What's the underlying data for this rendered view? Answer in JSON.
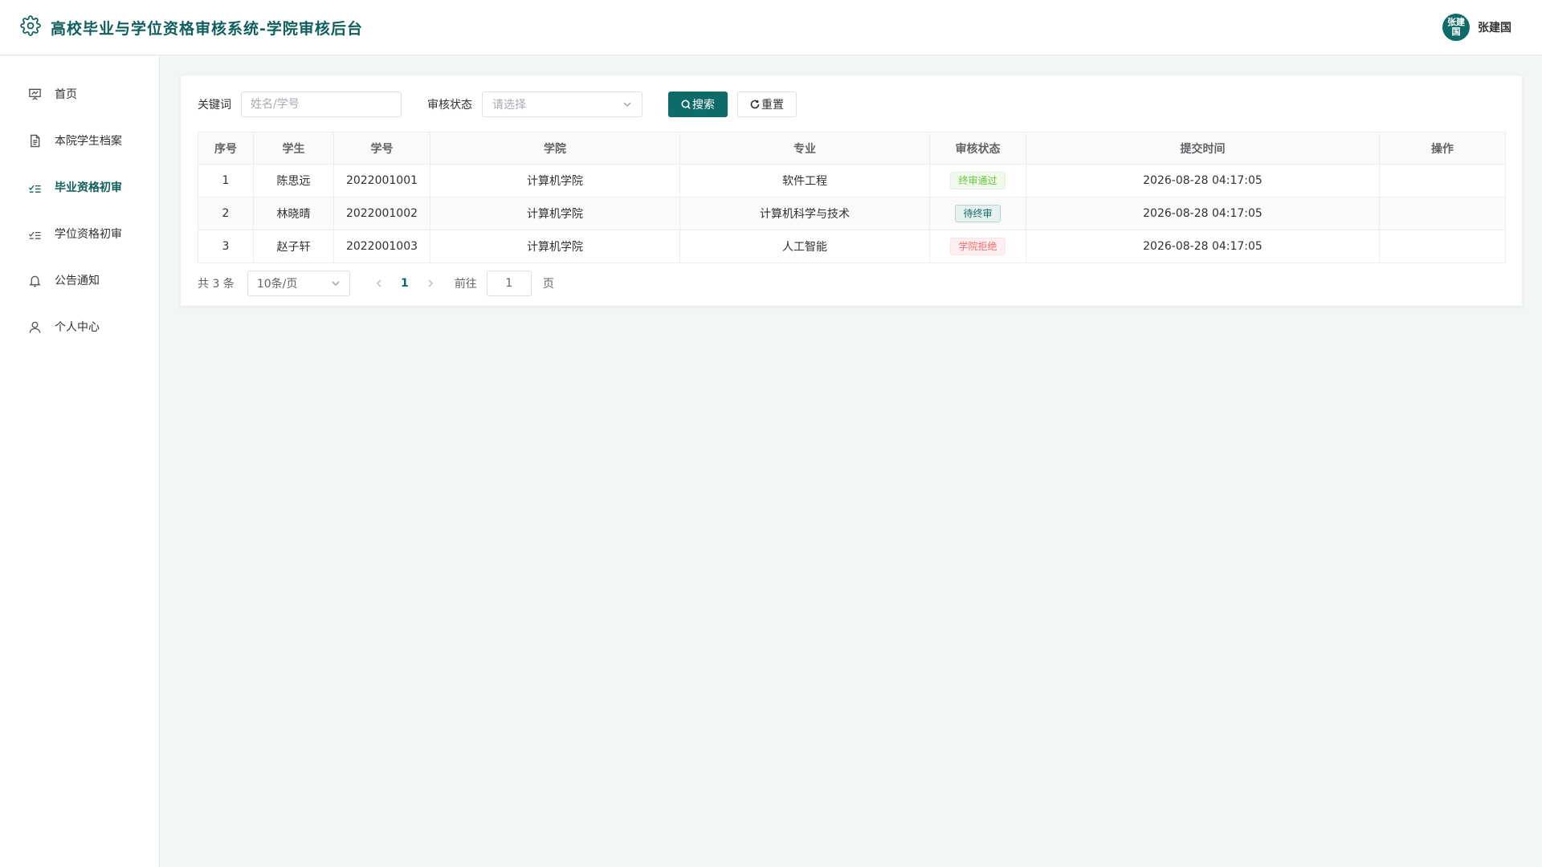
{
  "app": {
    "title": "高校毕业与学位资格审核系统-学院审核后台"
  },
  "user": {
    "name": "张建国",
    "avatar_text": "张建国"
  },
  "sidebar": {
    "items": [
      {
        "label": "首页",
        "icon": "presentation-icon"
      },
      {
        "label": "本院学生档案",
        "icon": "document-icon"
      },
      {
        "label": "毕业资格初审",
        "icon": "checklist-icon",
        "active": true
      },
      {
        "label": "学位资格初审",
        "icon": "checklist-icon"
      },
      {
        "label": "公告通知",
        "icon": "bell-icon"
      },
      {
        "label": "个人中心",
        "icon": "user-icon"
      }
    ]
  },
  "filters": {
    "keyword_label": "关键词",
    "keyword_placeholder": "姓名/学号",
    "keyword_value": "",
    "status_label": "审核状态",
    "status_placeholder": "请选择",
    "search_label": "搜索",
    "reset_label": "重置"
  },
  "table": {
    "headers": [
      "序号",
      "学生",
      "学号",
      "学院",
      "专业",
      "审核状态",
      "提交时间",
      "操作"
    ],
    "rows": [
      {
        "index": "1",
        "student": "陈思远",
        "id": "2022001001",
        "college": "计算机学院",
        "major": "软件工程",
        "status": "终审通过",
        "status_type": "success",
        "time": "2026-08-28 04:17:05",
        "action": ""
      },
      {
        "index": "2",
        "student": "林晓晴",
        "id": "2022001002",
        "college": "计算机学院",
        "major": "计算机科学与技术",
        "status": "待终审",
        "status_type": "info",
        "time": "2026-08-28 04:17:05",
        "action": ""
      },
      {
        "index": "3",
        "student": "赵子轩",
        "id": "2022001003",
        "college": "计算机学院",
        "major": "人工智能",
        "status": "学院拒绝",
        "status_type": "danger",
        "time": "2026-08-28 04:17:05",
        "action": ""
      }
    ]
  },
  "pagination": {
    "total_text": "共 3 条",
    "page_size": "10条/页",
    "current_page": "1",
    "goto_label": "前往",
    "goto_value": "1",
    "page_unit": "页"
  },
  "colors": {
    "primary": "#0f6b67",
    "success": "#67c23a",
    "danger": "#f56c6c"
  }
}
